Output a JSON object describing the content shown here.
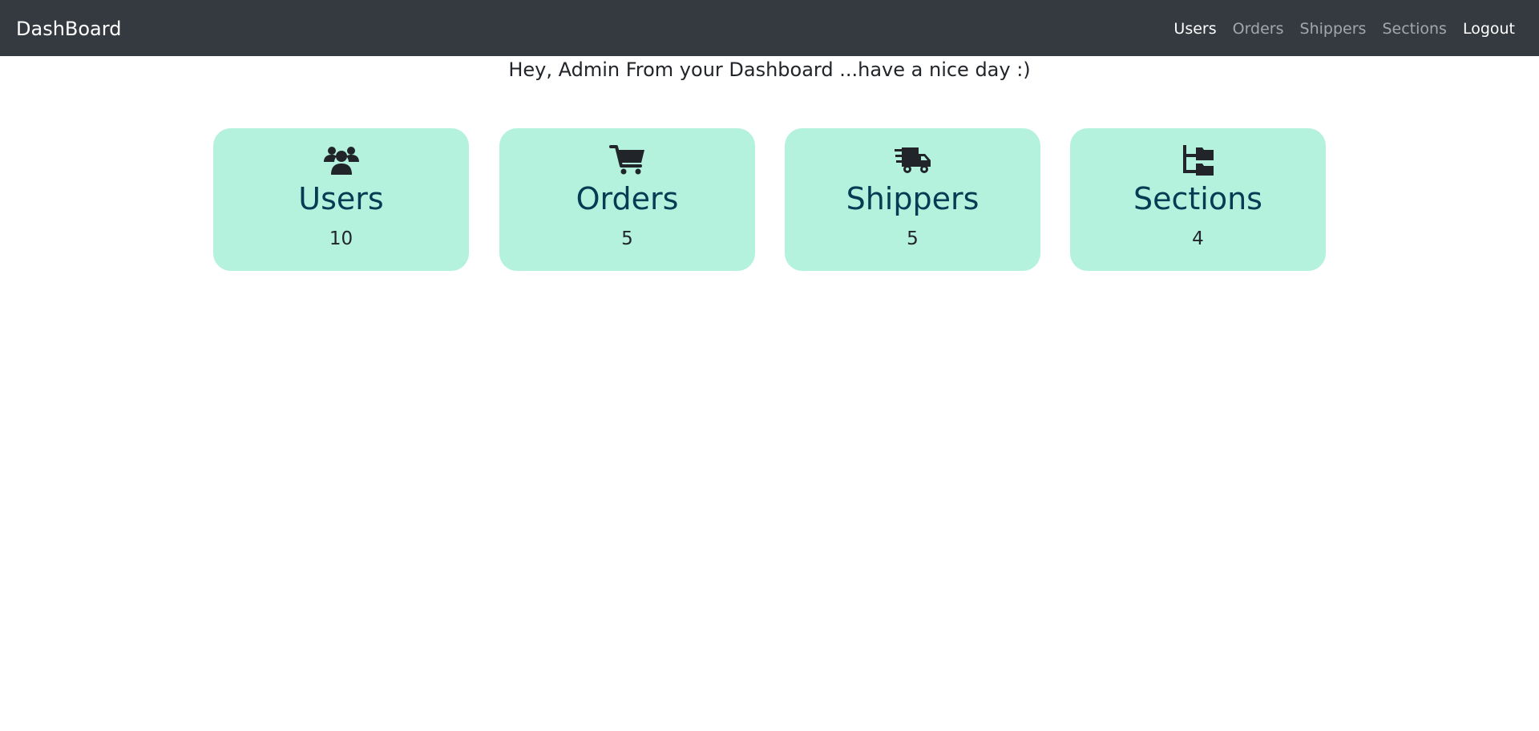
{
  "navbar": {
    "brand": "DashBoard",
    "links": [
      {
        "label": "Users",
        "active": true
      },
      {
        "label": "Orders",
        "active": false
      },
      {
        "label": "Shippers",
        "active": false
      },
      {
        "label": "Sections",
        "active": false
      },
      {
        "label": "Logout",
        "active": true
      }
    ]
  },
  "greeting": "Hey, Admin From your Dashboard ...have a nice day :)",
  "cards": [
    {
      "title": "Users",
      "count": "10",
      "icon": "users-icon"
    },
    {
      "title": "Orders",
      "count": "5",
      "icon": "shopping-cart-icon"
    },
    {
      "title": "Shippers",
      "count": "5",
      "icon": "truck-fast-icon"
    },
    {
      "title": "Sections",
      "count": "4",
      "icon": "folder-tree-icon"
    }
  ],
  "colors": {
    "navbar_bg": "#343a40",
    "card_bg": "#b4f2de",
    "card_title": "#073b54"
  }
}
